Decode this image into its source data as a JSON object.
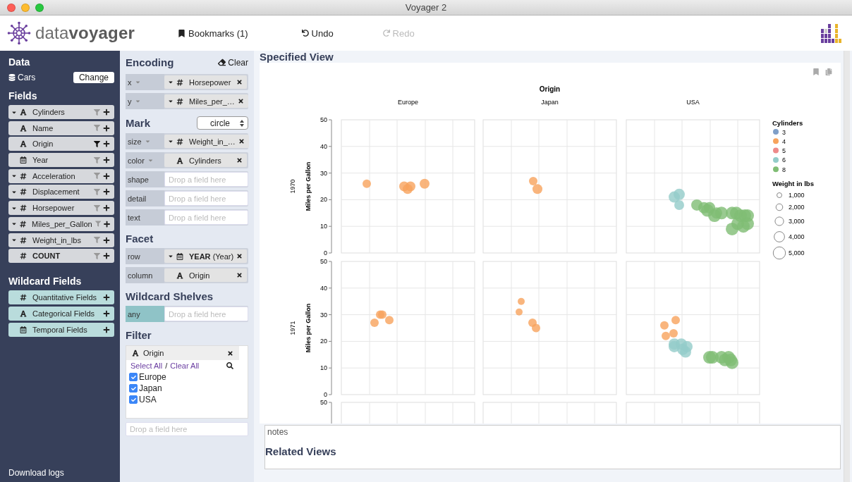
{
  "window": {
    "title": "Voyager 2"
  },
  "header": {
    "logo": "data**voyager**",
    "bookmarks": "Bookmarks (1)",
    "undo": {
      "label": "Undo",
      "disabled": false
    },
    "redo": {
      "label": "Redo",
      "disabled": true
    }
  },
  "data_panel": {
    "title": "Data",
    "dataset": "Cars",
    "change_button": "Change",
    "fields_title": "Fields",
    "fields": [
      {
        "kind": "nominal",
        "caret": true,
        "name": "Cylinders",
        "filtered": false
      },
      {
        "kind": "nominal",
        "caret": false,
        "name": "Name",
        "filtered": false
      },
      {
        "kind": "nominal",
        "caret": false,
        "name": "Origin",
        "filtered": true
      },
      {
        "kind": "temporal",
        "caret": false,
        "name": "Year",
        "filtered": false
      },
      {
        "kind": "quantitative",
        "caret": true,
        "name": "Acceleration",
        "filtered": false
      },
      {
        "kind": "quantitative",
        "caret": true,
        "name": "Displacement",
        "filtered": false
      },
      {
        "kind": "quantitative",
        "caret": true,
        "name": "Horsepower",
        "filtered": false
      },
      {
        "kind": "quantitative",
        "caret": true,
        "name": "Miles_per_Gallon",
        "filtered": false
      },
      {
        "kind": "quantitative",
        "caret": true,
        "name": "Weight_in_lbs",
        "filtered": false
      },
      {
        "kind": "count",
        "caret": false,
        "name": "COUNT",
        "filtered": false
      }
    ],
    "wildcard_title": "Wildcard Fields",
    "wildcard_fields": [
      {
        "kind": "quantitative",
        "name": "Quantitative Fields"
      },
      {
        "kind": "nominal",
        "name": "Categorical Fields"
      },
      {
        "kind": "temporal",
        "name": "Temporal Fields"
      }
    ],
    "download_logs": "Download logs"
  },
  "encoding": {
    "title": "Encoding",
    "clear": "Clear",
    "shelves": [
      {
        "channel": "x",
        "menu": true,
        "kind": "channel",
        "field": {
          "kind": "quantitative",
          "caret": true,
          "name": "Horsepower"
        }
      },
      {
        "channel": "y",
        "menu": true,
        "kind": "channel",
        "field": {
          "kind": "quantitative",
          "caret": true,
          "name": "Miles_per_…"
        }
      }
    ]
  },
  "mark": {
    "title": "Mark",
    "type": "circle",
    "shelves": [
      {
        "channel": "size",
        "menu": true,
        "kind": "channel",
        "field": {
          "kind": "quantitative",
          "caret": true,
          "name": "Weight_in_…"
        }
      },
      {
        "channel": "color",
        "menu": true,
        "kind": "channel",
        "field": {
          "kind": "nominal",
          "caret": false,
          "name": "Cylinders"
        }
      },
      {
        "channel": "shape",
        "menu": false,
        "kind": "channel",
        "placeholder": "Drop a field here"
      },
      {
        "channel": "detail",
        "menu": false,
        "kind": "channel",
        "placeholder": "Drop a field here"
      },
      {
        "channel": "text",
        "menu": false,
        "kind": "channel",
        "placeholder": "Drop a field here"
      }
    ]
  },
  "facet": {
    "title": "Facet",
    "shelves": [
      {
        "channel": "row",
        "menu": false,
        "kind": "channel",
        "field": {
          "kind": "temporal",
          "caret": true,
          "name": "YEAR",
          "suffix": "(Year)"
        }
      },
      {
        "channel": "column",
        "menu": false,
        "kind": "channel",
        "field": {
          "kind": "nominal",
          "caret": false,
          "name": "Origin"
        }
      }
    ]
  },
  "wildcard_shelves": {
    "title": "Wildcard Shelves",
    "shelves": [
      {
        "channel": "any",
        "menu": false,
        "kind": "wildcard",
        "placeholder": "Drop a field here"
      }
    ]
  },
  "filter": {
    "title": "Filter",
    "filters": [
      {
        "kind": "nominal",
        "field": "Origin",
        "select_all": "Select All",
        "separator": "/",
        "clear_all": "Clear All",
        "options": [
          {
            "label": "Europe",
            "checked": true
          },
          {
            "label": "Japan",
            "checked": true
          },
          {
            "label": "USA",
            "checked": true
          }
        ]
      }
    ],
    "drop_placeholder": "Drop a field here"
  },
  "main": {
    "heading": "Specified View",
    "chart": {
      "column_title": "Origin",
      "columns": [
        "Europe",
        "Japan",
        "USA"
      ],
      "rows": [
        {
          "label": "1970",
          "y_title": "Miles per Gallon",
          "y_ticks": [
            "50",
            "40",
            "30",
            "20",
            "10",
            "0"
          ]
        },
        {
          "label": "1971",
          "y_title": "Miles per Gallon",
          "y_ticks": [
            "50",
            "40",
            "30",
            "20",
            "10",
            "0"
          ]
        },
        {
          "y_ticks": [
            "50"
          ]
        }
      ],
      "color_legend": {
        "title": "Cylinders",
        "items": [
          {
            "label": "3",
            "color": "#7f9fc8"
          },
          {
            "label": "4",
            "color": "#f7a35c"
          },
          {
            "label": "5",
            "color": "#ee8a8a"
          },
          {
            "label": "6",
            "color": "#93ccc9"
          },
          {
            "label": "8",
            "color": "#80bd74"
          }
        ]
      },
      "size_legend": {
        "title": "Weight in lbs",
        "items": [
          "1,000",
          "2,000",
          "3,000",
          "4,000",
          "5,000"
        ]
      }
    },
    "notes": {
      "placeholder": "notes"
    },
    "related_heading": "Related Views"
  }
}
